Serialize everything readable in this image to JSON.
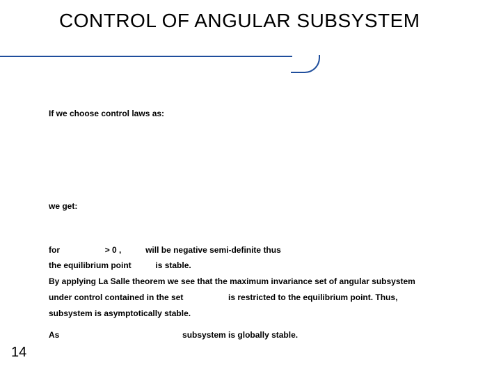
{
  "title": "CONTROL OF ANGULAR SUBSYSTEM",
  "page_number": "14",
  "text": {
    "line_choose": "If we choose control laws as:",
    "line_weget": "we get:",
    "for": "for",
    "gt0": "> 0 ,",
    "neg_semi": "will be negative semi-definite thus",
    "eq_point": "the equilibrium point",
    "is_stable": "is stable.",
    "lasalle": "By applying La Salle theorem we see that the maximum invariance set of angular subsystem",
    "under_control": "under control contained in the set",
    "restricted": "is restricted to the equilibrium point. Thus,",
    "asym": "subsystem is asymptotically stable.",
    "as": "As",
    "global": "subsystem is globally stable."
  }
}
